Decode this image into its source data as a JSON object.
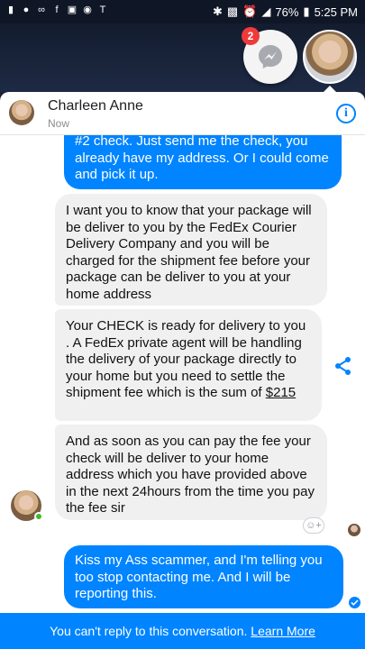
{
  "status_bar": {
    "battery": "76%",
    "time": "5:25 PM"
  },
  "chat_heads": {
    "badge_count": "2"
  },
  "header": {
    "name": "Charleen Anne",
    "subtitle": "Now",
    "info_label": "i"
  },
  "messages": [
    {
      "direction": "outgoing",
      "text": "#2 check.  Just send me the check,  you already have my address. Or I  could come and pick it up."
    },
    {
      "direction": "incoming",
      "text": "I want you to know that your package will be deliver to you by the FedEx Courier Delivery Company and you will be charged for the shipment fee before your package can be deliver to you at your home address"
    },
    {
      "direction": "incoming",
      "text_before": "Your CHECK is ready for delivery to you . A FedEx private agent will be handling the delivery of your package directly to your home but you need to settle the shipment fee which is the sum of ",
      "amount": "$215"
    },
    {
      "direction": "incoming",
      "text": "And as soon as you can pay the fee your check will be deliver to your home address which you have provided above in the next 24hours from the time you pay the fee sir"
    },
    {
      "direction": "outgoing",
      "text": "Kiss my Ass scammer,  and I'm telling you too stop contacting me. And I will be reporting this."
    }
  ],
  "footer": {
    "notice": "You can't reply to this conversation. ",
    "link": "Learn More"
  },
  "colors": {
    "accent": "#0084ff",
    "incoming_bubble": "#f1f0f0",
    "online": "#42b72a",
    "badge": "#f03a3a"
  },
  "icons": [
    "message-icon",
    "messenger-icon",
    "voicemail-icon",
    "facebook-icon",
    "gallery-icon",
    "camera-icon",
    "tmobile-icon",
    "bluetooth-icon",
    "nfc-icon",
    "alarm-icon",
    "signal-icon",
    "battery-icon",
    "info-icon",
    "share-icon",
    "add-reaction-icon",
    "delivered-check-icon"
  ]
}
